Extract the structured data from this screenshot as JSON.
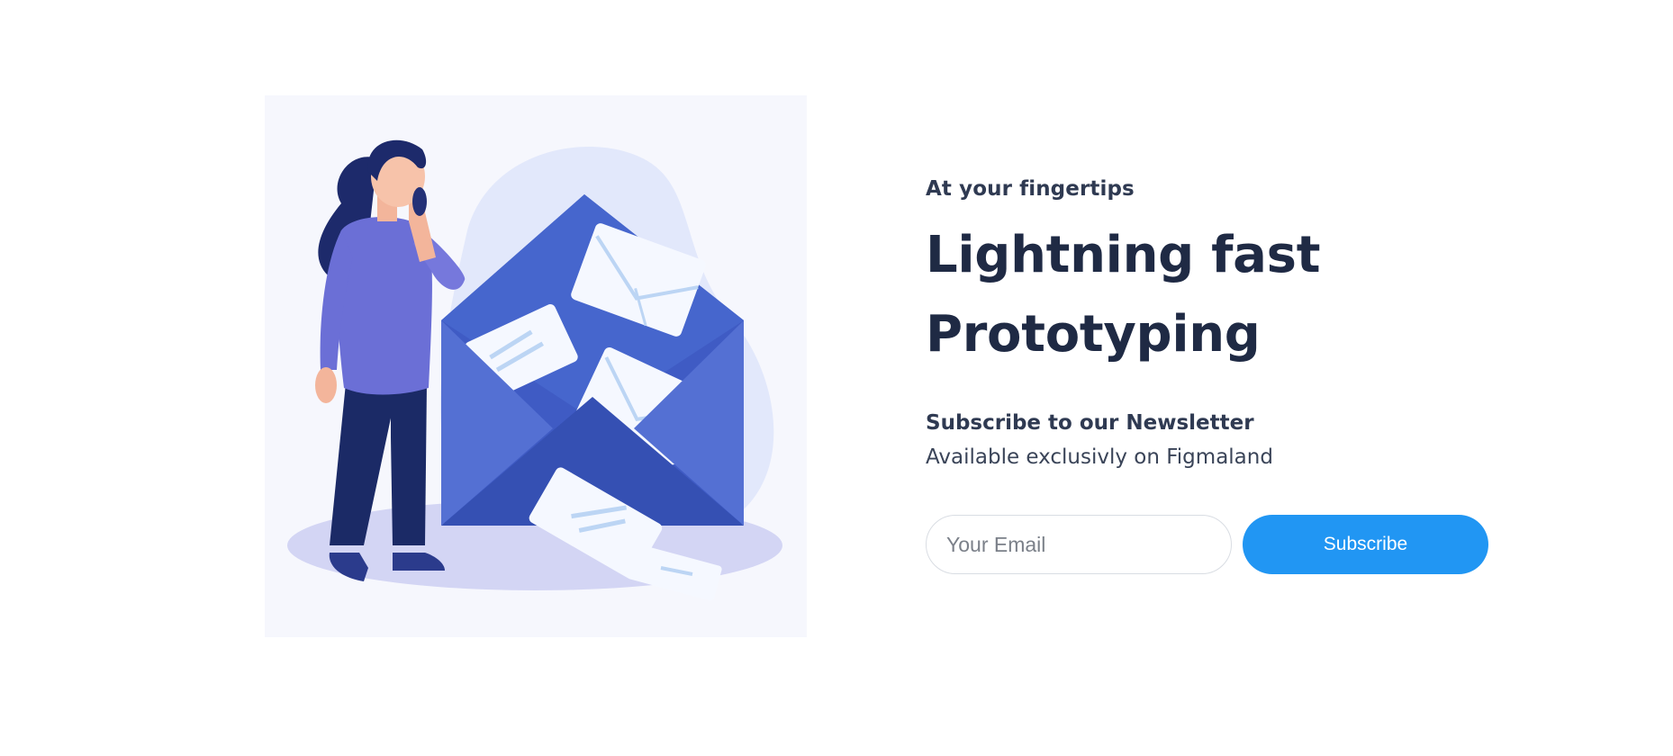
{
  "hero": {
    "eyebrow": "At your fingertips",
    "headline_line1": "Lightning fast",
    "headline_line2": "Prototyping",
    "newsletter_title": "Subscribe to our Newsletter",
    "newsletter_text": "Available exclusivly on Figmaland"
  },
  "form": {
    "email_placeholder": "Your Email",
    "email_value": "",
    "subscribe_label": "Subscribe"
  },
  "colors": {
    "accent": "#2196f3",
    "heading": "#1f2a44",
    "text": "#2f3a52",
    "envelope": "#3f5bc4",
    "illustration_bg": "#f6f7fd"
  }
}
